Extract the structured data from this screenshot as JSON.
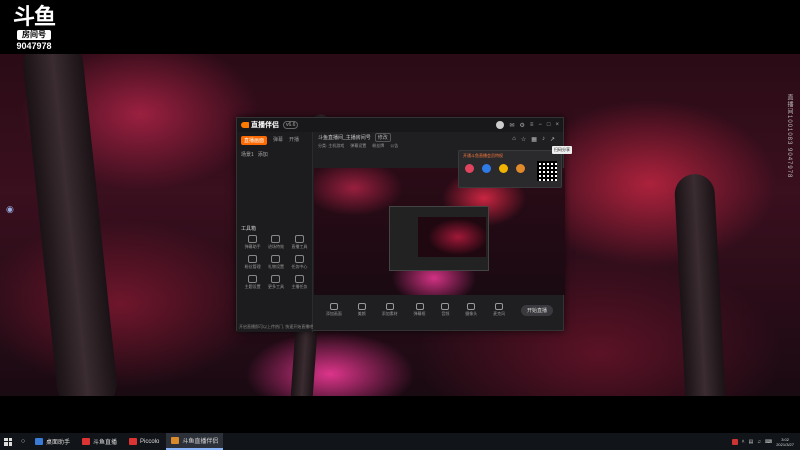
{
  "watermark": {
    "logo": "斗鱼",
    "tag": "房间号",
    "room_id": "9047978"
  },
  "side_text": "直播间1001083 9047978",
  "app": {
    "name": "直播伴侣",
    "version": "v6.6",
    "left_tabs": [
      "直播画面",
      "弹幕",
      "开播"
    ],
    "scene": [
      "场景1",
      "添加"
    ],
    "tools_title": "工具箱",
    "tools": [
      "弹幕助手",
      "进场特效",
      "直播工具",
      "粉丝管理",
      "礼物设置",
      "任务中心",
      "主题设置",
      "更多工具",
      "主播任务"
    ],
    "status": "开启直播即可以上传热门, 快速开始直播吧",
    "room_title": "斗鱼直播间_主播房间号",
    "room_chip": "修改",
    "room_sub": [
      "分类: 主机游戏",
      "弹幕设置",
      "粉丝牌",
      "公告"
    ],
    "controls": [
      "添加画面",
      "美颜",
      "添加素材",
      "弹幕框",
      "音频",
      "摄像头",
      "麦克风"
    ],
    "start_button": "开始直播"
  },
  "popup": {
    "title": "开通斗鱼直播会员特权"
  },
  "tooltip": "扫码分享",
  "taskbar": {
    "tasks": [
      {
        "label": "桌面助手",
        "color": "#3a7bd5"
      },
      {
        "label": "斗鱼直播",
        "color": "#d33"
      },
      {
        "label": "Piccolo",
        "color": "#d33"
      },
      {
        "label": "斗鱼直播伴侣",
        "color": "#d98a2a",
        "active": true
      }
    ],
    "clock_time": "3:02",
    "clock_date": "2021/3/27"
  }
}
